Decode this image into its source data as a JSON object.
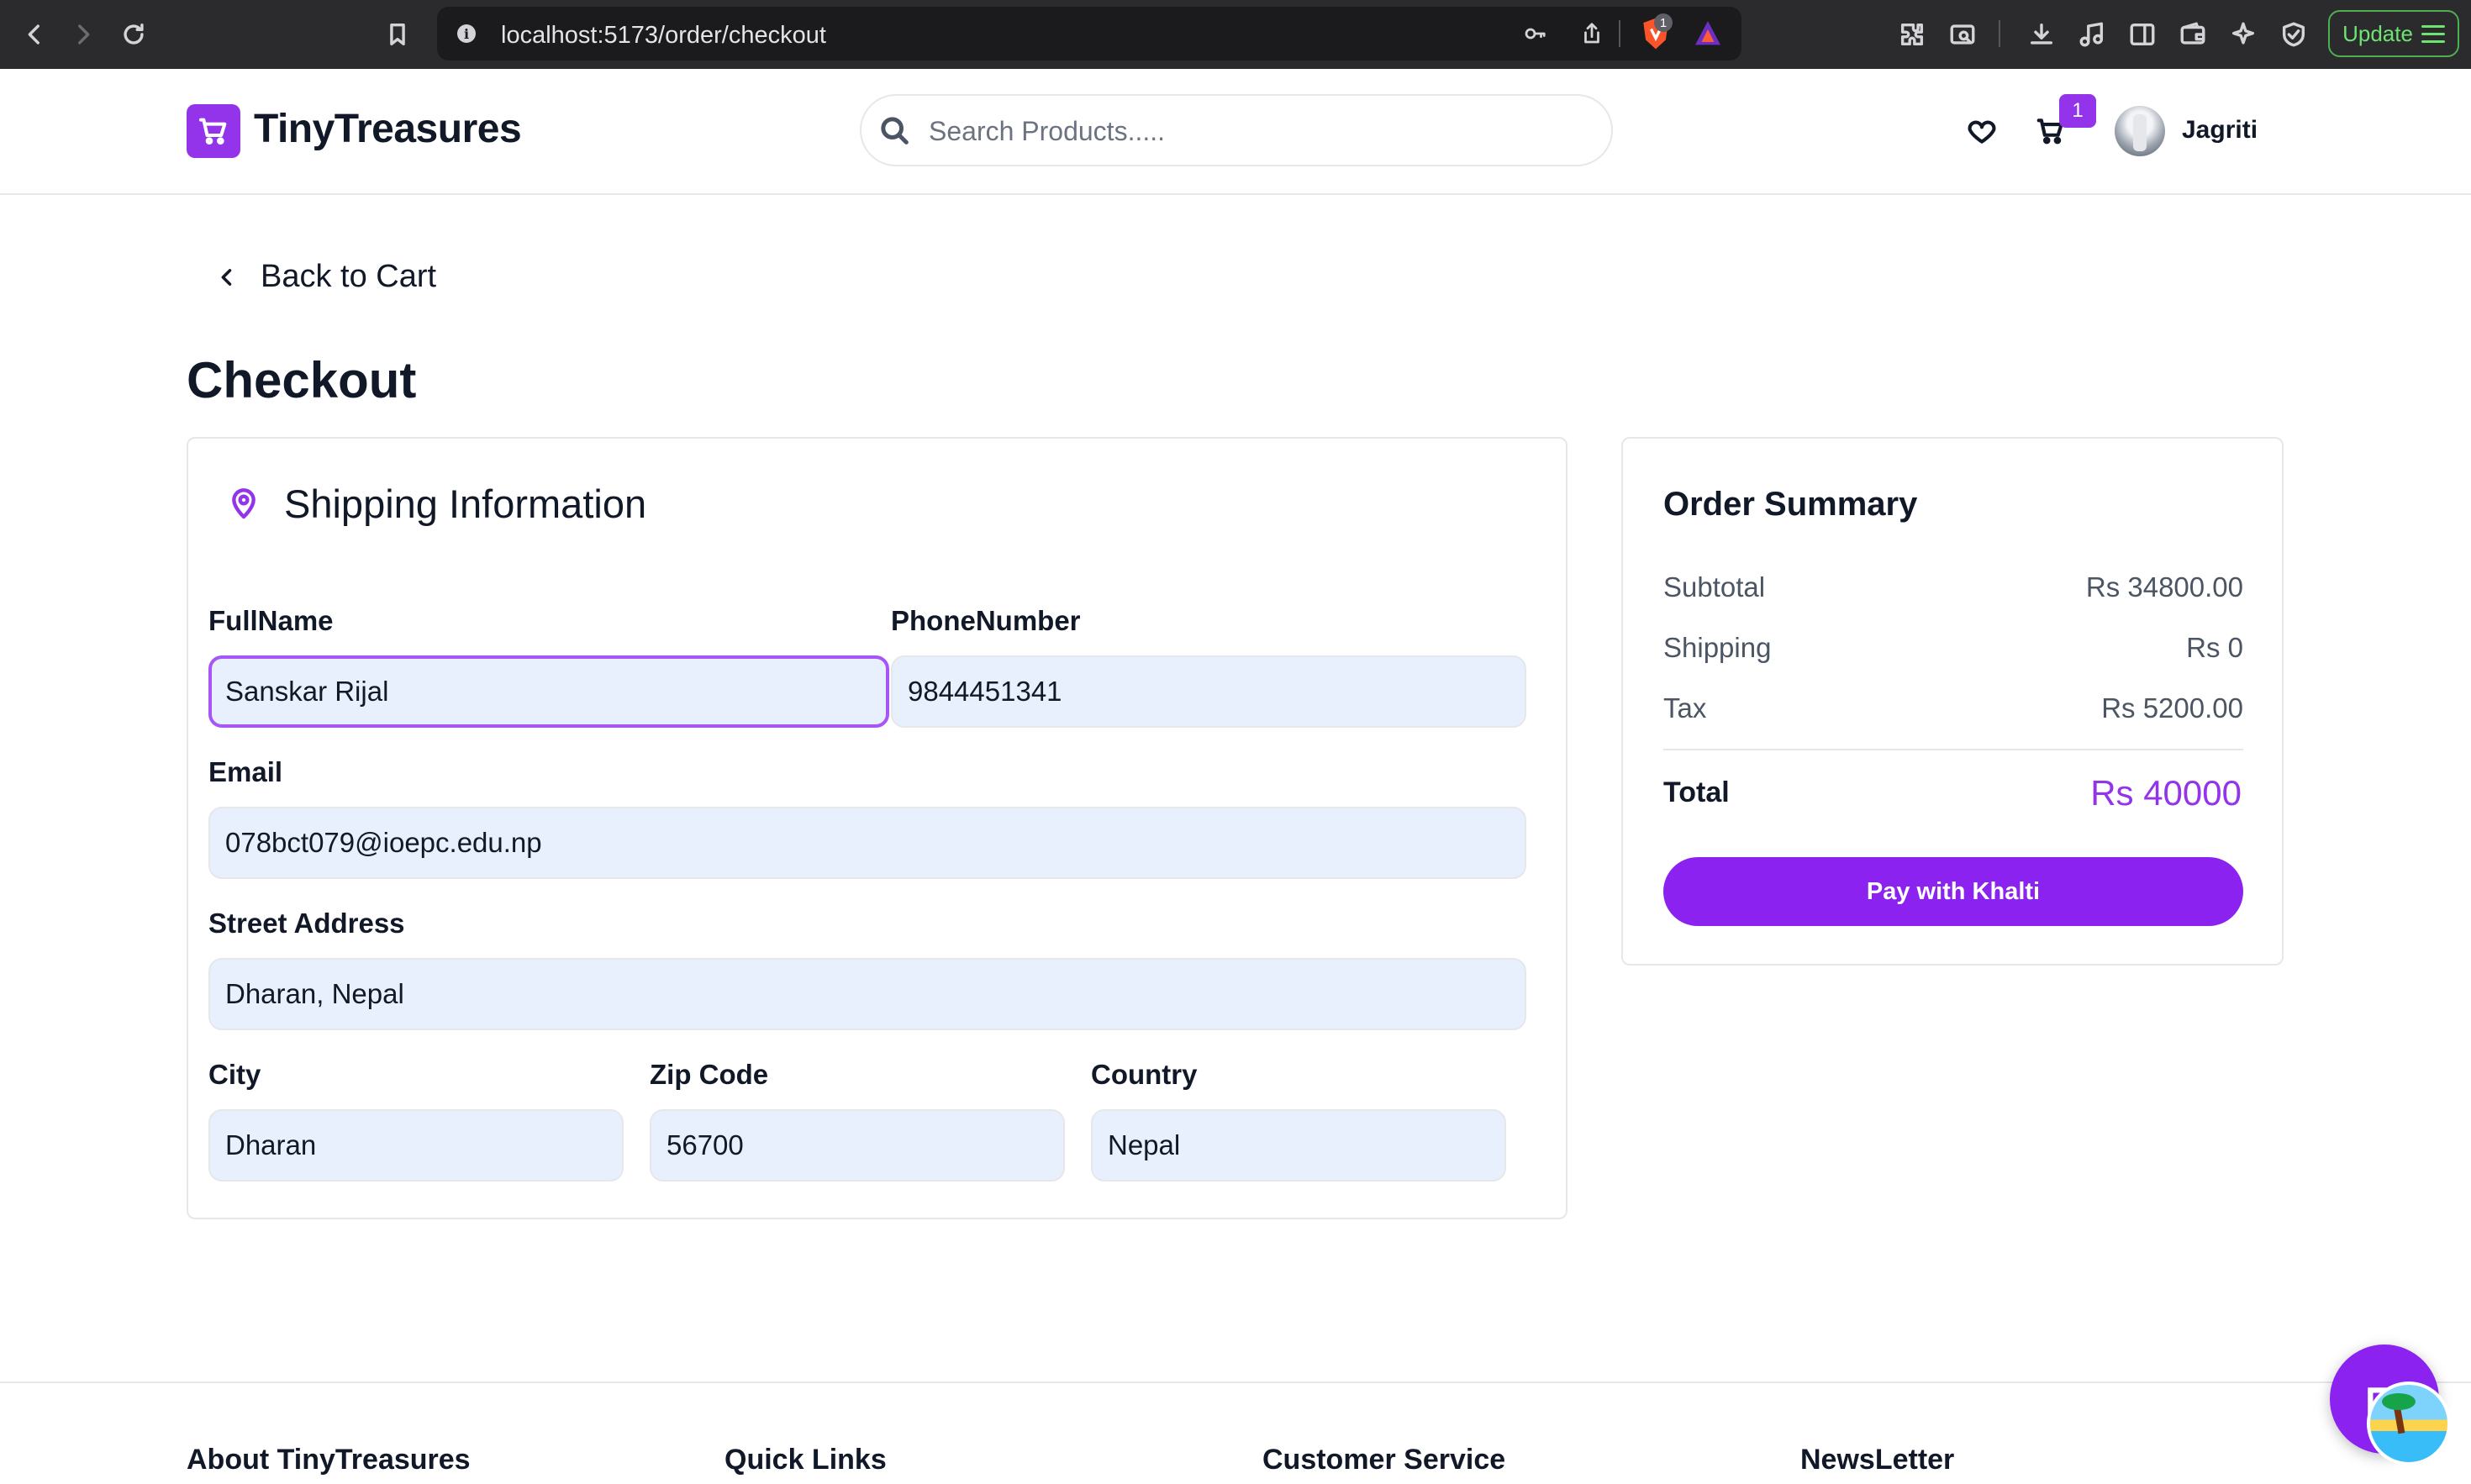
{
  "browser": {
    "url": "localhost:5173/order/checkout",
    "shield_count": "1",
    "update_label": "Update"
  },
  "header": {
    "brand": "TinyTreasures",
    "search_placeholder": "Search Products.....",
    "cart_count": "1",
    "user_name": "Jagriti"
  },
  "nav": {
    "back_label": "Back to Cart"
  },
  "page": {
    "title": "Checkout"
  },
  "shipping": {
    "title": "Shipping Information",
    "fields": {
      "full_name": {
        "label": "FullName",
        "value": "Sanskar Rijal"
      },
      "phone": {
        "label": "PhoneNumber",
        "value": "9844451341"
      },
      "email": {
        "label": "Email",
        "value": "078bct079@ioepc.edu.np"
      },
      "street": {
        "label": "Street Address",
        "value": "Dharan, Nepal"
      },
      "city": {
        "label": "City",
        "value": "Dharan"
      },
      "zip": {
        "label": "Zip Code",
        "value": "56700"
      },
      "country": {
        "label": "Country",
        "value": "Nepal"
      }
    }
  },
  "summary": {
    "title": "Order Summary",
    "subtotal_label": "Subtotal",
    "subtotal_value": "Rs 34800.00",
    "shipping_label": "Shipping",
    "shipping_value": "Rs 0",
    "tax_label": "Tax",
    "tax_value": "Rs 5200.00",
    "total_label": "Total",
    "total_value": "Rs 40000",
    "pay_label": "Pay with Khalti"
  },
  "footer": {
    "about": "About TinyTreasures",
    "quick_links": "Quick Links",
    "customer_service": "Customer Service",
    "newsletter": "NewsLetter"
  },
  "colors": {
    "accent": "#9333ea",
    "button": "#8b22f0",
    "input_bg": "#e8f0fe",
    "focus_border": "#a855f7"
  }
}
